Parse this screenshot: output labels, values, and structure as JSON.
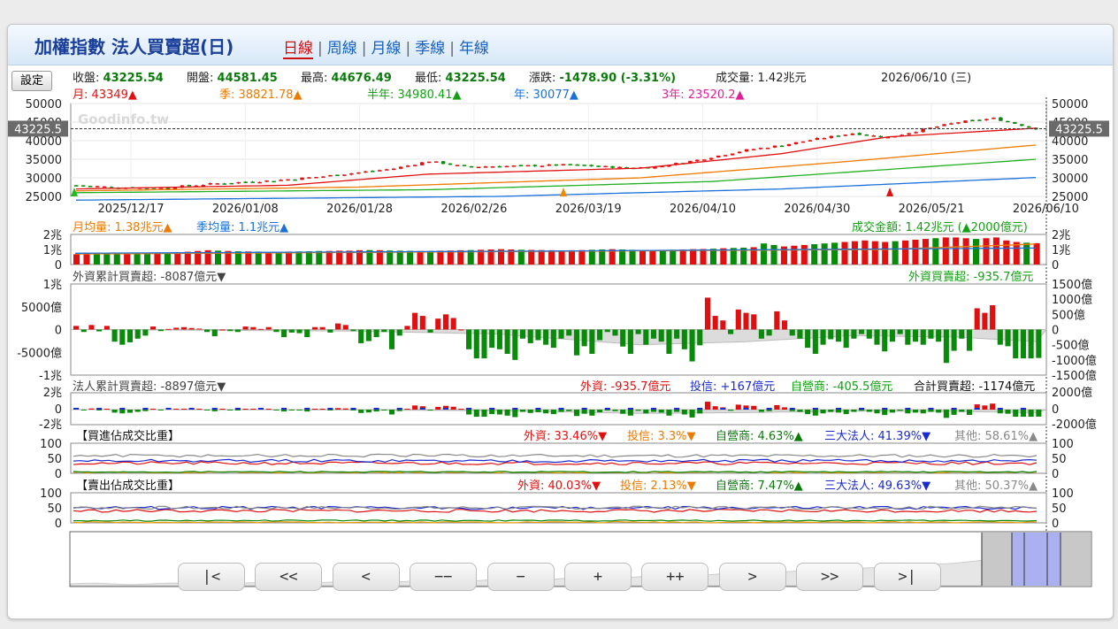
{
  "header": {
    "title": "加權指數 法人買賣超(日)",
    "tabs": [
      "日線",
      "周線",
      "月線",
      "季線",
      "年線"
    ],
    "active_tab": 0
  },
  "settings_label": "設定",
  "quote": {
    "close_label": "收盤:",
    "close": "43225.54",
    "open_label": "開盤:",
    "open": "44581.45",
    "high_label": "最高:",
    "high": "44676.49",
    "low_label": "最低:",
    "low": "43225.54",
    "change_label": "漲跌:",
    "change": "-1478.90 (-3.31%)",
    "volume_label": "成交量:",
    "volume": "1.42兆元",
    "date": "2026/06/10 (三)"
  },
  "ma": {
    "m": "月: 43349▲",
    "q": "季: 38821.78▲",
    "h": "半年: 34980.41▲",
    "y": "年: 30077▲",
    "y3": "3年: 23520.2▲"
  },
  "watermark": "Goodinfo.tw",
  "price_tag": "43225.5",
  "volume_panel": {
    "m_avg": "月均量: 1.38兆元▲",
    "q_avg": "季均量: 1.1兆元▲",
    "turnover": "成交金額: 1.42兆元 (▲2000億元)"
  },
  "foreign_panel": {
    "left": "外資累計買賣超: -8087億元▼",
    "right": "外資買賣超: -935.7億元"
  },
  "inst_panel": {
    "left": "法人累計買賣超: -8897億元▼",
    "foreign": "外資: -935.7億元",
    "trust": "投信: +167億元",
    "dealer": "自營商: -405.5億元",
    "total": "合計買賣超: -1174億元"
  },
  "buy_ratio": {
    "label": "【買進佔成交比重】",
    "foreign": "外資: 33.46%▼",
    "trust": "投信: 3.3%▼",
    "dealer": "自營商: 4.63%▲",
    "three": "三大法人: 41.39%▼",
    "other": "其他: 58.61%▲"
  },
  "sell_ratio": {
    "label": "【賣出佔成交比重】",
    "foreign": "外資: 40.03%▼",
    "trust": "投信: 2.13%▼",
    "dealer": "自營商: 7.47%▲",
    "three": "三大法人: 49.63%▼",
    "other": "其他: 50.37%▲"
  },
  "nav_buttons": [
    "|<",
    "<<",
    "<",
    "−−",
    "−",
    "+",
    "++",
    ">",
    ">>",
    ">|"
  ],
  "colors": {
    "up": "#e01010",
    "down": "#0a8a0a",
    "month_ma": "#e01010",
    "quarter_ma": "#ee7a00",
    "half_ma": "#22b022",
    "year_ma": "#1a70d8"
  },
  "chart_data": [
    {
      "type": "candlestick",
      "name": "加權指數 日K",
      "x_ticks": [
        "2025/12/17",
        "2026/01/08",
        "2026/01/28",
        "2026/02/26",
        "2026/03/19",
        "2026/04/10",
        "2026/04/30",
        "2026/05/21",
        "2026/06/10"
      ],
      "ylim": [
        25000,
        50000
      ],
      "y_ticks": [
        25000,
        30000,
        35000,
        40000,
        45000,
        50000
      ],
      "close_path": [
        [
          0,
          28000
        ],
        [
          6,
          27400
        ],
        [
          12,
          27300
        ],
        [
          20,
          28500
        ],
        [
          28,
          29300
        ],
        [
          35,
          30400
        ],
        [
          45,
          32500
        ],
        [
          50,
          34500
        ],
        [
          55,
          33000
        ],
        [
          62,
          33200
        ],
        [
          70,
          33500
        ],
        [
          78,
          32700
        ],
        [
          82,
          32900
        ],
        [
          88,
          34800
        ],
        [
          95,
          37500
        ],
        [
          100,
          38800
        ],
        [
          105,
          40500
        ],
        [
          110,
          42000
        ],
        [
          115,
          40900
        ],
        [
          120,
          43000
        ],
        [
          125,
          45000
        ],
        [
          130,
          46000
        ],
        [
          136,
          43225
        ]
      ],
      "series": [
        {
          "name": "月",
          "values": [
            [
              0,
              27000
            ],
            [
              30,
              28000
            ],
            [
              50,
              31000
            ],
            [
              80,
              32600
            ],
            [
              100,
              36500
            ],
            [
              115,
              41000
            ],
            [
              136,
              43349
            ]
          ]
        },
        {
          "name": "季",
          "values": [
            [
              0,
              26500
            ],
            [
              40,
              27500
            ],
            [
              80,
              30000
            ],
            [
              110,
              34500
            ],
            [
              136,
              38821
            ]
          ]
        },
        {
          "name": "半年",
          "values": [
            [
              0,
              26000
            ],
            [
              50,
              26800
            ],
            [
              90,
              29000
            ],
            [
              136,
              34980
            ]
          ]
        },
        {
          "name": "年",
          "values": [
            [
              0,
              24000
            ],
            [
              60,
              25000
            ],
            [
              100,
              27000
            ],
            [
              136,
              30077
            ]
          ]
        }
      ],
      "last_close": 43225.5
    },
    {
      "type": "bar",
      "name": "成交金額",
      "unit": "兆",
      "ylim": [
        0,
        2
      ],
      "y_ticks": [
        "2兆",
        "1兆",
        "0"
      ],
      "values": [
        0.68,
        0.68,
        0.68,
        0.7,
        0.72,
        0.73,
        0.72,
        0.74,
        0.76,
        0.78,
        0.8,
        0.85,
        0.9,
        0.95,
        0.92,
        0.9,
        0.88,
        0.87,
        0.86,
        0.85,
        0.85,
        0.86,
        0.87,
        0.88,
        0.9,
        0.9,
        0.92,
        0.92,
        0.95,
        0.96,
        0.95,
        0.93,
        0.92,
        0.91,
        0.9,
        0.9,
        0.92,
        0.93,
        0.95,
        0.96,
        0.98,
        1.0,
        1.02,
        1.0,
        0.98,
        0.97,
        0.96,
        0.95,
        0.94,
        0.95,
        0.96,
        0.98,
        1.0,
        1.02,
        1.0,
        0.98,
        0.97,
        0.96,
        0.97,
        0.98,
        1.0,
        1.02,
        1.03,
        1.05,
        1.08,
        1.1,
        1.12,
        1.15,
        1.4,
        1.3,
        1.2,
        1.25,
        1.3,
        1.35,
        1.4,
        1.45,
        1.5,
        1.55,
        1.6,
        1.55,
        1.5,
        1.55,
        1.6,
        1.65,
        1.7,
        1.75,
        1.8,
        1.8,
        1.75,
        1.7,
        1.75,
        1.8,
        1.6,
        1.5,
        1.45,
        1.42
      ],
      "month_avg": [
        [
          0,
          0.7
        ],
        [
          40,
          0.85
        ],
        [
          80,
          1.0
        ],
        [
          96,
          1.38
        ]
      ],
      "quarter_avg": [
        [
          0,
          0.75
        ],
        [
          48,
          0.9
        ],
        [
          96,
          1.1
        ]
      ]
    },
    {
      "type": "bar",
      "name": "外資買賣超",
      "unit": "億",
      "ylim": [
        -1500,
        1500
      ],
      "y_ticks_left": [
        "1兆",
        "5000億",
        "0",
        "-5000億",
        "-1兆"
      ],
      "y_ticks_right": [
        "1500億",
        "1000億",
        "500億",
        "0",
        "-500億",
        "-1000億",
        "-1500億"
      ],
      "values": [
        120,
        -80,
        150,
        -60,
        120,
        -400,
        -500,
        -420,
        -300,
        -200,
        100,
        -50,
        20,
        60,
        80,
        50,
        30,
        -80,
        -220,
        0,
        -50,
        -80,
        100,
        80,
        20,
        80,
        -80,
        -250,
        -100,
        -120,
        -250,
        80,
        80,
        -100,
        200,
        150,
        -50,
        -450,
        -380,
        -250,
        -80,
        -650,
        -200,
        120,
        550,
        450,
        -100,
        360,
        500,
        380,
        0,
        -650,
        -950,
        -950,
        -600,
        -650,
        -800,
        -1000,
        -300,
        -450,
        -350,
        -500,
        -600,
        -300,
        -200,
        -850,
        -550,
        -800,
        -350,
        -80,
        -200,
        -560,
        -800,
        -150,
        -500,
        -300,
        -400,
        -800,
        -300,
        -650,
        -1050,
        -520,
        1050,
        450,
        300,
        -150,
        660,
        550,
        500,
        -300,
        -200,
        600,
        300,
        -200,
        -300,
        -600,
        -800,
        -500,
        -320,
        -400,
        -600,
        -300,
        -150,
        -300,
        -500,
        -720,
        -400,
        -150,
        -500,
        -400,
        -500,
        -300,
        -400,
        -1100,
        -700,
        -300,
        -700,
        700,
        550,
        800,
        -500,
        -550,
        -950,
        -950,
        -950,
        -935.7
      ],
      "cumulative_shape": [
        [
          0,
          0
        ],
        [
          40,
          -50
        ],
        [
          60,
          -150
        ],
        [
          80,
          -500
        ],
        [
          95,
          -400
        ],
        [
          110,
          -200
        ],
        [
          125,
          -250
        ],
        [
          136,
          -400
        ]
      ]
    },
    {
      "type": "bar",
      "name": "法人買賣超",
      "ylim": [
        -2000,
        2000
      ],
      "y_ticks_left": [
        "2兆",
        "0",
        "-2兆"
      ],
      "y_ticks_right": [
        "2000億",
        "0",
        "-2000億"
      ]
    },
    {
      "type": "line",
      "name": "買進佔成交比重",
      "ylim": [
        0,
        100
      ],
      "y_ticks": [
        100,
        50,
        0
      ],
      "series": [
        {
          "name": "外資",
          "value": 33.46
        },
        {
          "name": "投信",
          "value": 3.3
        },
        {
          "name": "自營商",
          "value": 4.63
        },
        {
          "name": "三大法人",
          "value": 41.39
        },
        {
          "name": "其他",
          "value": 58.61
        }
      ]
    },
    {
      "type": "line",
      "name": "賣出佔成交比重",
      "ylim": [
        0,
        100
      ],
      "y_ticks": [
        100,
        50,
        0
      ],
      "series": [
        {
          "name": "外資",
          "value": 40.03
        },
        {
          "name": "投信",
          "value": 2.13
        },
        {
          "name": "自營商",
          "value": 7.47
        },
        {
          "name": "三大法人",
          "value": 49.63
        },
        {
          "name": "其他",
          "value": 50.37
        }
      ]
    }
  ]
}
